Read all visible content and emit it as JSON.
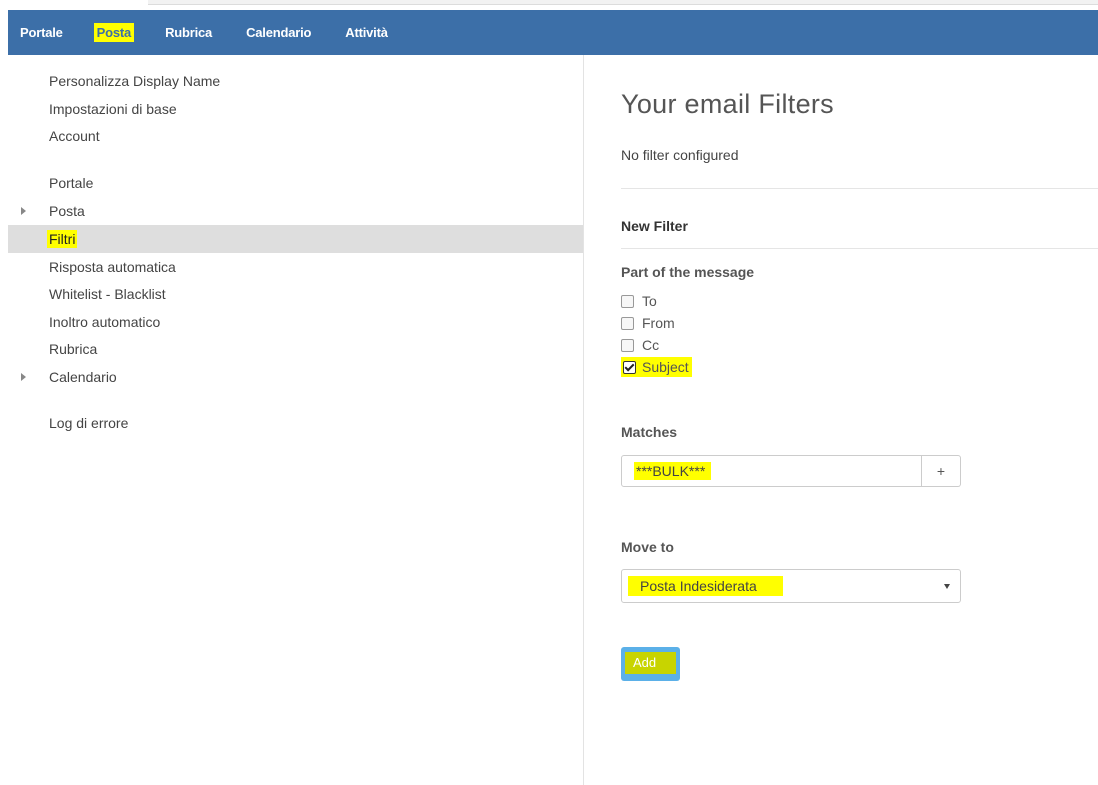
{
  "nav": {
    "items": [
      {
        "label": "Portale",
        "highlighted": false
      },
      {
        "label": "Posta",
        "highlighted": true
      },
      {
        "label": "Rubrica",
        "highlighted": false
      },
      {
        "label": "Calendario",
        "highlighted": false
      },
      {
        "label": "Attività",
        "highlighted": false
      }
    ]
  },
  "sidebar": {
    "items": [
      {
        "label": "Personalizza Display Name",
        "arrow": false,
        "active": false
      },
      {
        "label": "Impostazioni di base",
        "arrow": false,
        "active": false
      },
      {
        "label": "Account",
        "arrow": false,
        "active": false
      },
      {
        "label": "Portale",
        "arrow": false,
        "active": false
      },
      {
        "label": "Posta",
        "arrow": true,
        "active": false
      },
      {
        "label": "Filtri",
        "arrow": false,
        "active": true
      },
      {
        "label": "Risposta automatica",
        "arrow": false,
        "active": false
      },
      {
        "label": "Whitelist - Blacklist",
        "arrow": false,
        "active": false
      },
      {
        "label": "Inoltro automatico",
        "arrow": false,
        "active": false
      },
      {
        "label": "Rubrica",
        "arrow": false,
        "active": false
      },
      {
        "label": "Calendario",
        "arrow": true,
        "active": false
      },
      {
        "label": "Log di errore",
        "arrow": false,
        "active": false
      }
    ]
  },
  "main": {
    "title": "Your email Filters",
    "no_filter": "No filter configured",
    "new_filter_heading": "New Filter",
    "part_heading": "Part of the message",
    "parts": [
      {
        "label": "To",
        "checked": false
      },
      {
        "label": "From",
        "checked": false
      },
      {
        "label": "Cc",
        "checked": false
      },
      {
        "label": "Subject",
        "checked": true
      }
    ],
    "matches_heading": "Matches",
    "matches_value": "***BULK***",
    "matches_add": "+",
    "move_heading": "Move to",
    "move_value": "Posta Indesiderata",
    "add_button": "Add"
  },
  "colors": {
    "navbar": "#3c6fa8",
    "highlight": "#ffff00",
    "button": "#5bb0e8"
  }
}
